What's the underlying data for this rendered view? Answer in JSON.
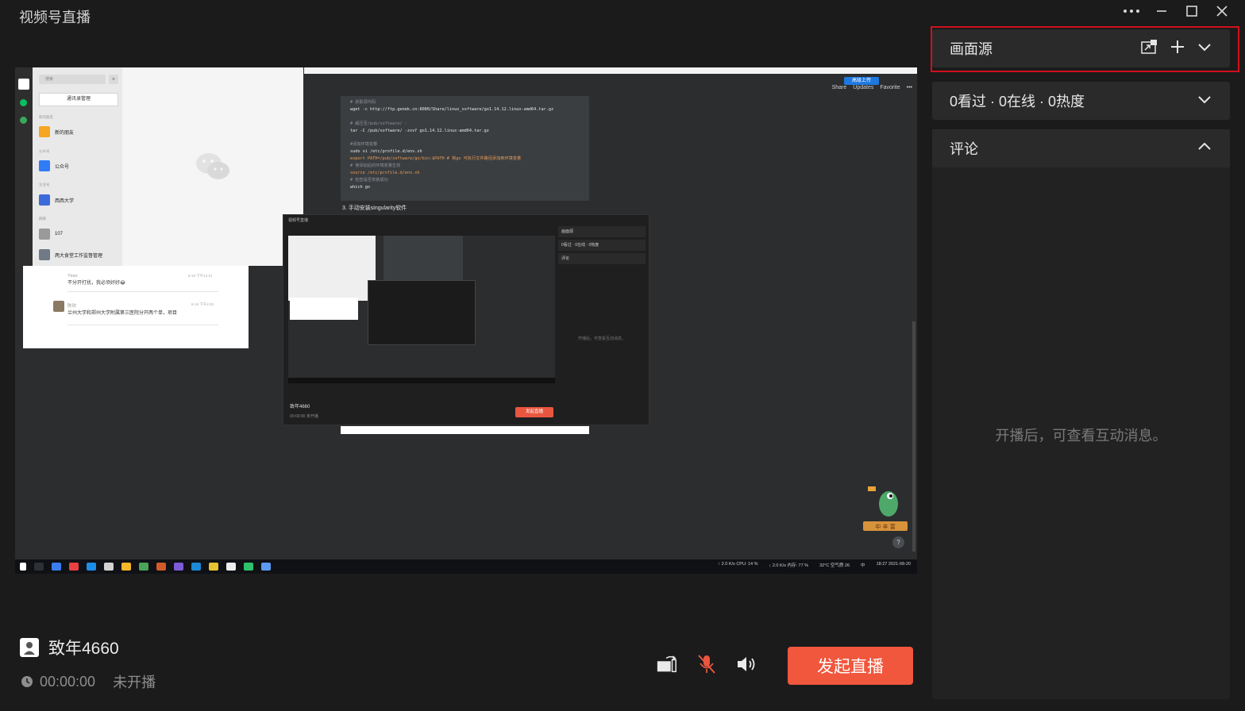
{
  "app": {
    "title": "视频号直播"
  },
  "window": {
    "more": "•••",
    "minimize": "minimize",
    "maximize": "maximize",
    "close": "close"
  },
  "preview": {
    "ide_actions": [
      "Share",
      "Updates",
      "Favorite",
      "•••"
    ],
    "share_button": "高级上传",
    "code_lines": [
      "# 获取源代码",
      "wget -c http://ftp.genek.cn:8080/Share/linux_software/go1.14.12.linux-amd64.tar.gz",
      "",
      "# 解压至/pub/software/ ：",
      "tar -C /pub/software/ -zxvf go1.14.12.linux-amd64.tar.gz",
      "",
      "#添加环境变量",
      "sudo vi /etc/profile.d/env.sh",
      "export PATH=/pub/software/go/bin:$PATH # 将go 可执行文件路径添加到环境变量",
      "# 使添加后的环境变量生效",
      "source  /etc/profile.d/env.sh",
      "# 检查是否安装成功",
      "which go"
    ],
    "code_heading": "3. 手动安装singularity软件",
    "wechat": {
      "search_placeholder": "搜索",
      "plus": "+",
      "contacts_button": "通讯录管理",
      "sections": [
        "新的朋友",
        "公众号",
        "企业号",
        "群聊"
      ],
      "items": [
        "新的朋友",
        "公众号",
        "西西大学",
        "107",
        "两大食堂工作监督管理"
      ]
    },
    "chat": {
      "msg1_name": "Yiran",
      "msg1_text": "不分开打扰，我必须好好😂",
      "msg1_time": "8-19 下午12:21",
      "msg2_name": "陈欣",
      "msg2_text": "兰州大学和郑州大学附属第三医院分开两个单，项目",
      "msg2_time": "8-19 下午2:49"
    },
    "nested": {
      "title": "视频号直播",
      "source": "画面源",
      "stats": "0看过 · 0在线 · 0热度",
      "comment": "评论",
      "hint": "开播后，可查看互动消息。",
      "user": "致年4660",
      "timer": "00:00:00",
      "status": "未开播",
      "start": "发起直播"
    },
    "taskbar": {
      "net1": "↑ 2.0 K/s",
      "net2": "↓ 2.0 K/s",
      "cpu": "CPU: 14 %",
      "mem": "内存: 77 %",
      "weather": "32°C 空气质 26",
      "ime": "中",
      "time": "18:27",
      "date": "2021-08-20"
    },
    "mascot_text": "中 丰 富",
    "help": "?"
  },
  "broadcaster": {
    "name": "致年4660",
    "timer": "00:00:00",
    "status": "未开播"
  },
  "controls": {
    "start_label": "发起直播",
    "accent": "#f0573d",
    "mic_muted_color": "#e9563f"
  },
  "panel": {
    "source_label": "画面源",
    "stats_label": "0看过 · 0在线 · 0热度",
    "comment_label": "评论",
    "comment_hint": "开播后，可查看互动消息。",
    "highlight_color": "#d0101c"
  }
}
